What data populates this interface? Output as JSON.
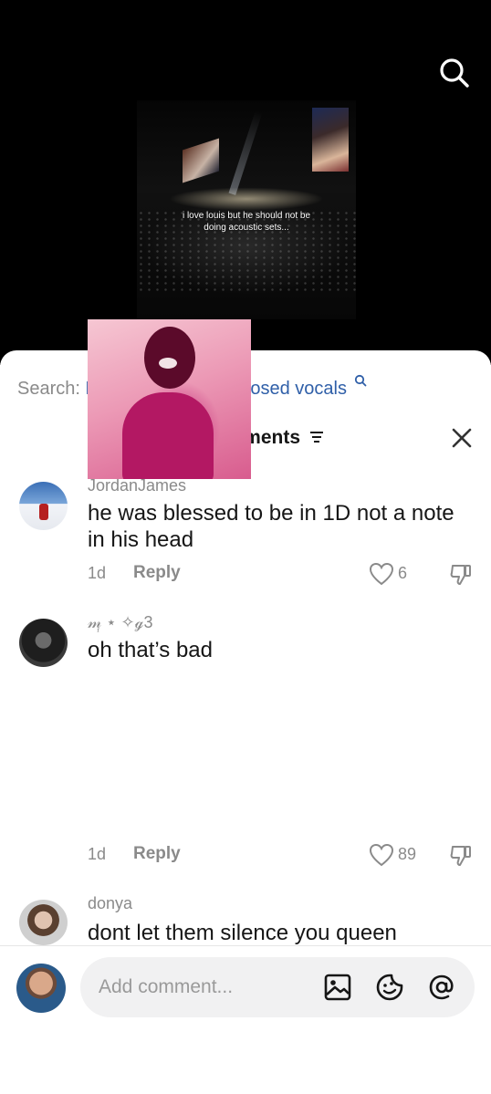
{
  "video": {
    "caption": "i love louis but he should not be doing acoustic sets..."
  },
  "sheet": {
    "search_prefix": "Search:",
    "search_query": "Louis Tomlinson exposed vocals",
    "comment_count_label": "719 comments"
  },
  "comments": [
    {
      "username": "JordanJames",
      "text": "he was blessed to be in 1D not a note in his head",
      "age": "1d",
      "reply_label": "Reply",
      "likes": "6"
    },
    {
      "username": "𝓂᷊ ⋆ ✧ℊ3",
      "text": "oh that’s bad",
      "age": "1d",
      "reply_label": "Reply",
      "likes": "89"
    },
    {
      "username": "donya",
      "text": "dont let them silence you queen"
    }
  ],
  "composer": {
    "placeholder": "Add comment..."
  },
  "colors": {
    "link_blue": "#2f5fa8",
    "muted_gray": "#8a8a8a",
    "text_dark": "#161616"
  }
}
